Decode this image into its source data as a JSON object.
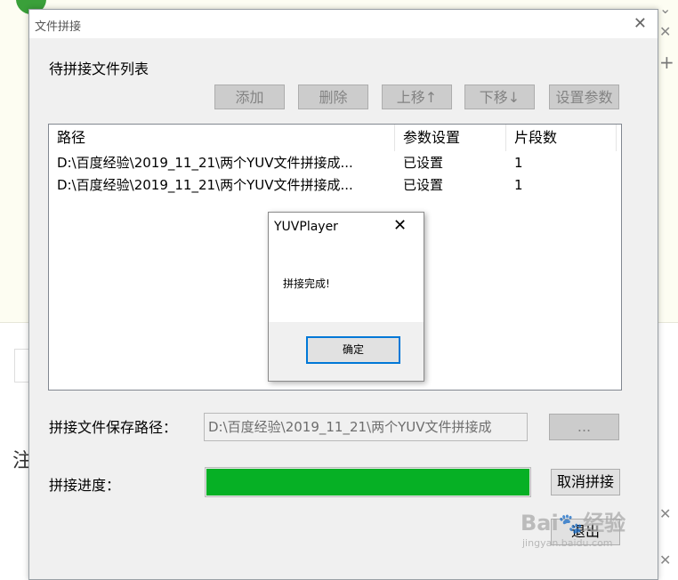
{
  "main_dialog": {
    "title": "文件拼接",
    "list_section_label": "待拼接文件列表",
    "buttons": {
      "add": "添加",
      "delete": "删除",
      "move_up": "上移↑",
      "move_down": "下移↓",
      "set_params": "设置参数",
      "browse": "...",
      "cancel_join": "取消拼接",
      "bottom_partial": "退出"
    },
    "table": {
      "columns": [
        "路径",
        "参数设置",
        "片段数"
      ],
      "rows": [
        {
          "path": "D:\\百度经验\\2019_11_21\\两个YUV文件拼接成...",
          "param": "已设置",
          "segments": "1"
        },
        {
          "path": "D:\\百度经验\\2019_11_21\\两个YUV文件拼接成...",
          "param": "已设置",
          "segments": "1"
        }
      ]
    },
    "save_path_label": "拼接文件保存路径：",
    "save_path_value": "D:\\百度经验\\2019_11_21\\两个YUV文件拼接成",
    "progress_label": "拼接进度：",
    "progress_fraction": 1.0
  },
  "message_box": {
    "title": "YUVPlayer",
    "message": "拼接完成!",
    "ok_label": "确定"
  },
  "background": {
    "side_char": "注",
    "watermark": "Bai",
    "watermark_cn": "经验",
    "watermark_sub": "jingyan.baidu.com"
  },
  "colors": {
    "progress_fill": "#06b025",
    "focus_border": "#0078d7"
  }
}
